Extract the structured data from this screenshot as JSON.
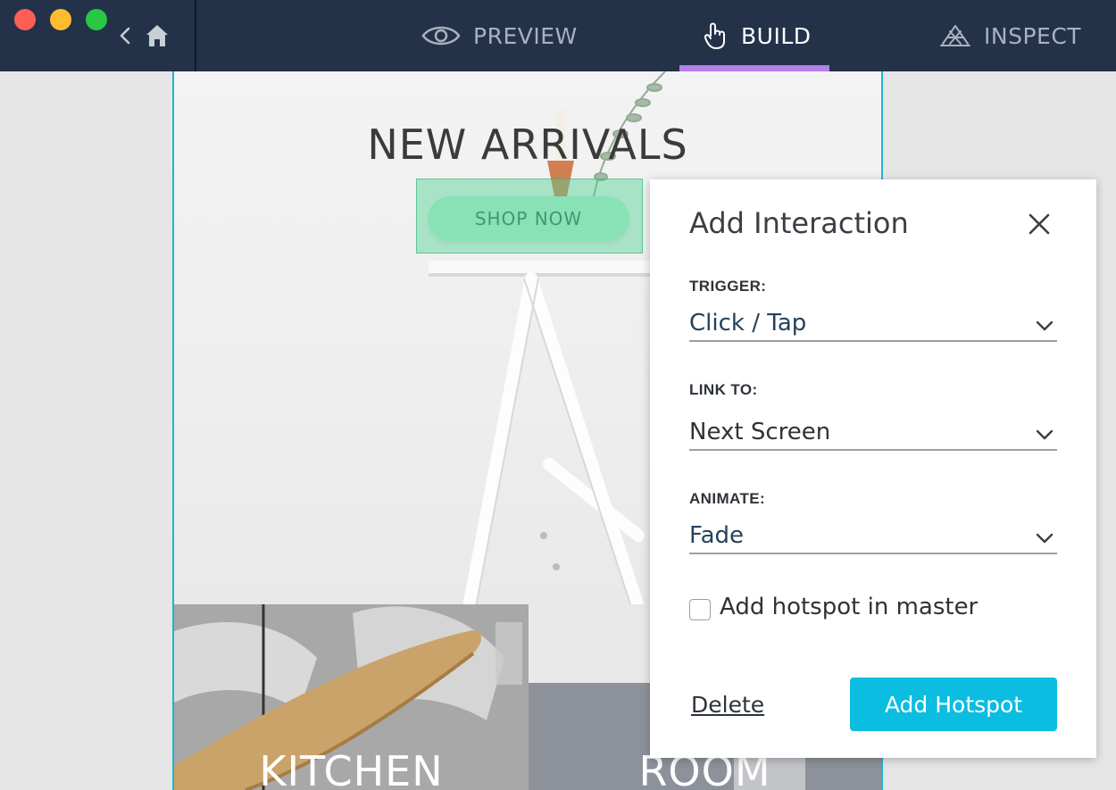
{
  "titlebar": {
    "back_icon": "chevron-left-icon",
    "home_icon": "home-icon"
  },
  "nav": {
    "tabs": [
      {
        "label": "PREVIEW",
        "icon": "eye-icon",
        "active": false
      },
      {
        "label": "BUILD",
        "icon": "pointer-hand-icon",
        "active": true
      },
      {
        "label": "INSPECT",
        "icon": "inspect-icon",
        "active": false
      }
    ],
    "active_color": "#b57ee8"
  },
  "canvas": {
    "hero_title": "NEW ARRIVALS",
    "shop_button": "SHOP NOW",
    "tiles": [
      {
        "label": "KITCHEN"
      },
      {
        "label": "ROOM"
      }
    ]
  },
  "panel": {
    "title": "Add Interaction",
    "trigger_label": "TRIGGER:",
    "trigger_value": "Click / Tap",
    "link_label": "LINK TO:",
    "link_value": "Next Screen",
    "animate_label": "ANIMATE:",
    "animate_value": "Fade",
    "master_checkbox_label": "Add hotspot in master",
    "master_checked": false,
    "delete_label": "Delete",
    "submit_label": "Add Hotspot",
    "accent_color": "#0bbde0"
  }
}
